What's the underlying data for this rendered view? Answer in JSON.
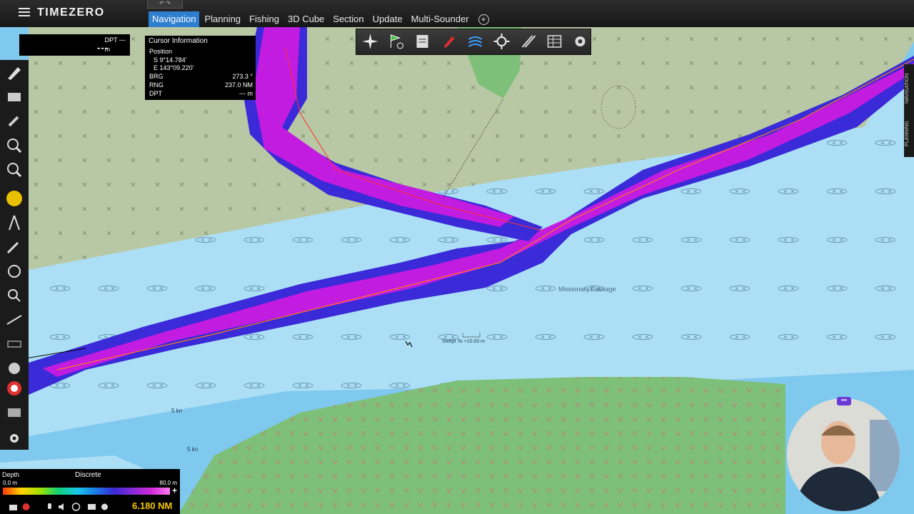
{
  "app": {
    "title": "TIMEZERO",
    "menu_icon": "hamburger-menu-icon"
  },
  "topbar": {
    "undo_redo": "↶ ↷"
  },
  "tabs": [
    {
      "label": "Navigation",
      "active": true
    },
    {
      "label": "Planning",
      "active": false
    },
    {
      "label": "Fishing",
      "active": false
    },
    {
      "label": "3D Cube",
      "active": false
    },
    {
      "label": "Section",
      "active": false
    },
    {
      "label": "Update",
      "active": false
    },
    {
      "label": "Multi-Sounder",
      "active": false
    }
  ],
  "add_tab_icon": "plus-circle-icon",
  "depth_panel": {
    "label": "DPT ---",
    "value": "---",
    "unit": "m"
  },
  "cursor_info": {
    "title": "Cursor Information",
    "position_label": "Position",
    "lat": "S 9°14.784'",
    "lon": "E 143°09.220'",
    "rows": [
      {
        "label": "BRG",
        "value": "273.3 °"
      },
      {
        "label": "RNG",
        "value": "237.0 NM"
      },
      {
        "label": "DPT",
        "value": "--- m"
      }
    ]
  },
  "tool_strip_icons": [
    "compass-rose-icon",
    "route-flag-icon",
    "chart-layers-icon",
    "pen-icon",
    "sounder-waves-icon",
    "plotter-settings-icon",
    "mark-pencil-icon",
    "table-grid-icon",
    "gear-icon"
  ],
  "left_toolbar_icons": [
    "pencil-tool-icon",
    "eraser-tool-icon",
    "brush-tool-icon",
    "zoom-in-icon",
    "zoom-out-icon",
    "pan-hand-icon",
    "compass-tool-icon",
    "pen-tool-icon",
    "circle-tool-icon",
    "search-tool-icon",
    "measure-tool-icon",
    "ruler-tool-icon",
    "zoom-tool-icon",
    "lifebuoy-icon",
    "layers-tool-icon"
  ],
  "settings_icon": "settings-cog-icon",
  "map": {
    "passage_label": "Missionary Passage",
    "swept_label": "Swept To  +10.00 m",
    "current_labels": [
      "5 kn",
      "5 kn"
    ],
    "colors": {
      "deep_water": "#7fc8ee",
      "shallow_water": "#acdff6",
      "land": "#7ec07a",
      "shoal": "#b8c8a0",
      "survey": "#c21ce0"
    }
  },
  "depth_scale": {
    "label": "Depth",
    "mode": "Discrete",
    "min": "0.0 m",
    "max": "80.0 m",
    "plus": "+"
  },
  "bottom_bar": {
    "icons": [
      "camera-icon",
      "record-icon",
      "mic-icon",
      "speaker-icon",
      "target-icon",
      "window-icon",
      "gear-icon"
    ],
    "range_readout": "6.180 NM"
  },
  "right_tabs": [
    "NAVIGATION",
    "PLANNING"
  ],
  "webcam_badge": "•••"
}
